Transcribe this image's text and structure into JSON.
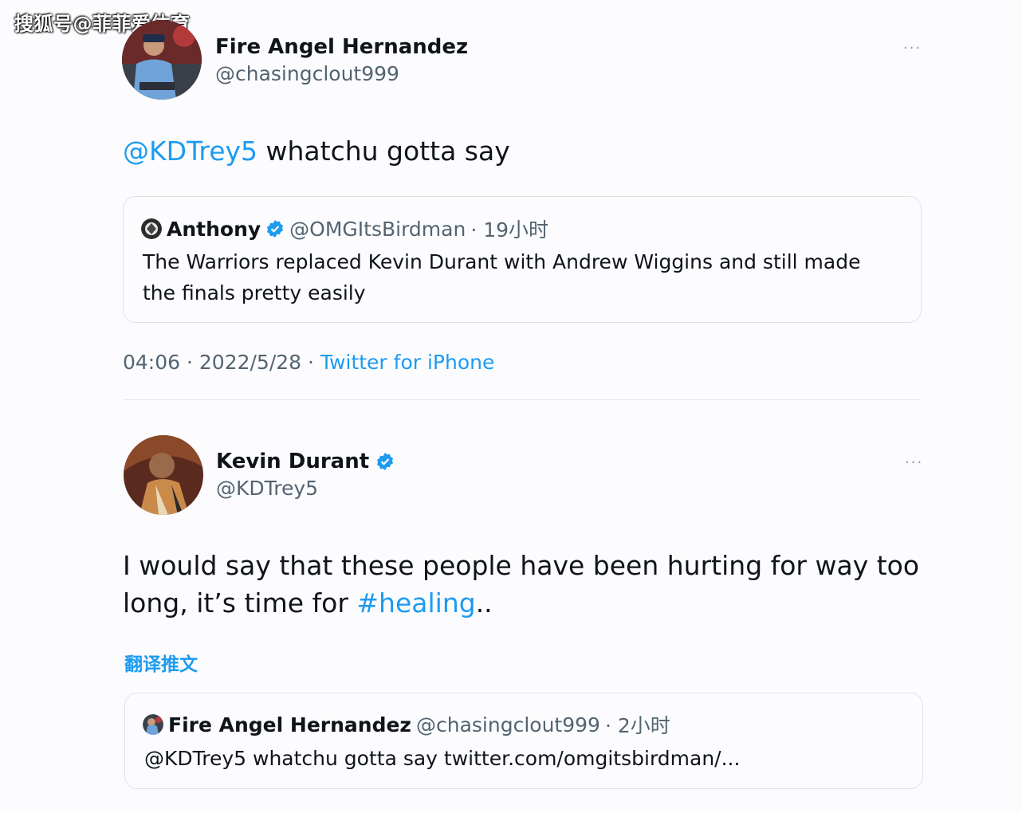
{
  "watermark": "搜狐号@菲菲爱体育",
  "tweet1": {
    "name": "Fire Angel Hernandez",
    "handle": "@chasingclout999",
    "more": "···",
    "mention": "@KDTrey5",
    "text": " whatchu gotta say",
    "quote": {
      "name": "Anthony",
      "handle": "@OMGItsBirdman",
      "time": "· 19小时",
      "body": "The Warriors replaced Kevin Durant with Andrew Wiggins and still made the finals pretty easily"
    },
    "time": "04:06 · 2022/5/28 · ",
    "source": "Twitter for iPhone"
  },
  "tweet2": {
    "name": "Kevin Durant",
    "handle": "@KDTrey5",
    "more": "···",
    "text_line1": "I would say that these people have been hurting for way too",
    "text_line2_prefix": "long, it’s time for ",
    "hashtag": "#healing",
    "text_suffix": "..",
    "translate": "翻译推文",
    "quote": {
      "name": "Fire Angel Hernandez",
      "handle": "@chasingclout999",
      "time": "· 2小时",
      "body": "@KDTrey5 whatchu gotta say twitter.com/omgitsbirdman/..."
    }
  },
  "colors": {
    "accent": "#1d9bf0",
    "text": "#0f1419",
    "muted": "#536471",
    "border": "#dfe3e6"
  }
}
